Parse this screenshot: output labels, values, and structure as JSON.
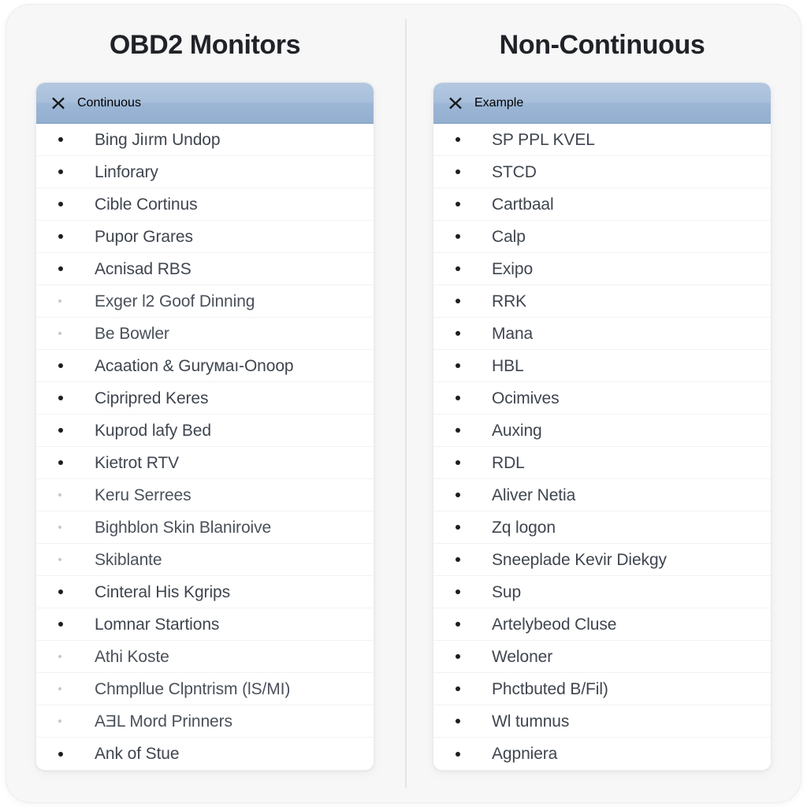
{
  "columns": [
    {
      "title": "OBD2 Monitors",
      "card": {
        "header_icon": "x-mark-icon",
        "header_label": "Continuous",
        "items": [
          {
            "label": "Bing Jiırm Undop",
            "faint": false
          },
          {
            "label": "Linforary",
            "faint": false
          },
          {
            "label": "Cible Cortinus",
            "faint": false
          },
          {
            "label": "Pupor Grares",
            "faint": false
          },
          {
            "label": "Acnisad RBS",
            "faint": false
          },
          {
            "label": "Exger l2 Goof Dinning",
            "faint": true
          },
          {
            "label": "Be Bowler",
            "faint": true
          },
          {
            "label": "Acaation & Guryмaı-Onoop",
            "faint": false
          },
          {
            "label": "Cipripred Keres",
            "faint": false
          },
          {
            "label": "Kuprod lafy Bed",
            "faint": false
          },
          {
            "label": "Kietrot RTV",
            "faint": false
          },
          {
            "label": "Keru Serrees",
            "faint": true
          },
          {
            "label": "Bighblon Skin Blaniroive",
            "faint": true
          },
          {
            "label": "Skiblante",
            "faint": true
          },
          {
            "label": "Cinteral His Kgrips",
            "faint": false
          },
          {
            "label": "Lomnar Startions",
            "faint": false
          },
          {
            "label": "Athi Koste",
            "faint": true
          },
          {
            "label": "Chmpllue Clpntrism (lS/MI)",
            "faint": true
          },
          {
            "label": "AƎL Mord Prinners",
            "faint": true
          },
          {
            "label": "Ank of Stue",
            "faint": false
          }
        ]
      }
    },
    {
      "title": "Non-Continuous",
      "card": {
        "header_icon": "x-mark-icon",
        "header_label": "Example",
        "items": [
          {
            "label": "SP PPL KVEL",
            "faint": false
          },
          {
            "label": "STCD",
            "faint": false
          },
          {
            "label": "Cartbaal",
            "faint": false
          },
          {
            "label": "Calp",
            "faint": false
          },
          {
            "label": "Exipo",
            "faint": false
          },
          {
            "label": "RRK",
            "faint": false
          },
          {
            "label": "Mana",
            "faint": false
          },
          {
            "label": "HBL",
            "faint": false
          },
          {
            "label": "Ocimives",
            "faint": false
          },
          {
            "label": "Auxing",
            "faint": false
          },
          {
            "label": "RDL",
            "faint": false
          },
          {
            "label": "Aliver Netia",
            "faint": false
          },
          {
            "label": "Zq logon",
            "faint": false
          },
          {
            "label": "Sneeplade Kevir Diekgy",
            "faint": false
          },
          {
            "label": "Sup",
            "faint": false
          },
          {
            "label": "Artelybeod Cluse",
            "faint": false
          },
          {
            "label": "Weloner",
            "faint": false
          },
          {
            "label": "Phctbuted B/Fil)",
            "faint": false
          },
          {
            "label": "Wl tumnus",
            "faint": false
          },
          {
            "label": "Agpniera",
            "faint": false
          }
        ]
      }
    }
  ],
  "colors": {
    "page_background": "#f7f7f8",
    "card_background": "#ffffff",
    "header_blue_top": "#b4c8e0",
    "header_blue_bottom": "#93afd0",
    "header_border": "#7e9ac0",
    "title_text": "#1f2227",
    "item_text": "#3f454e",
    "row_separator": "#f2f2f3",
    "divider": "#e4e4e7"
  }
}
